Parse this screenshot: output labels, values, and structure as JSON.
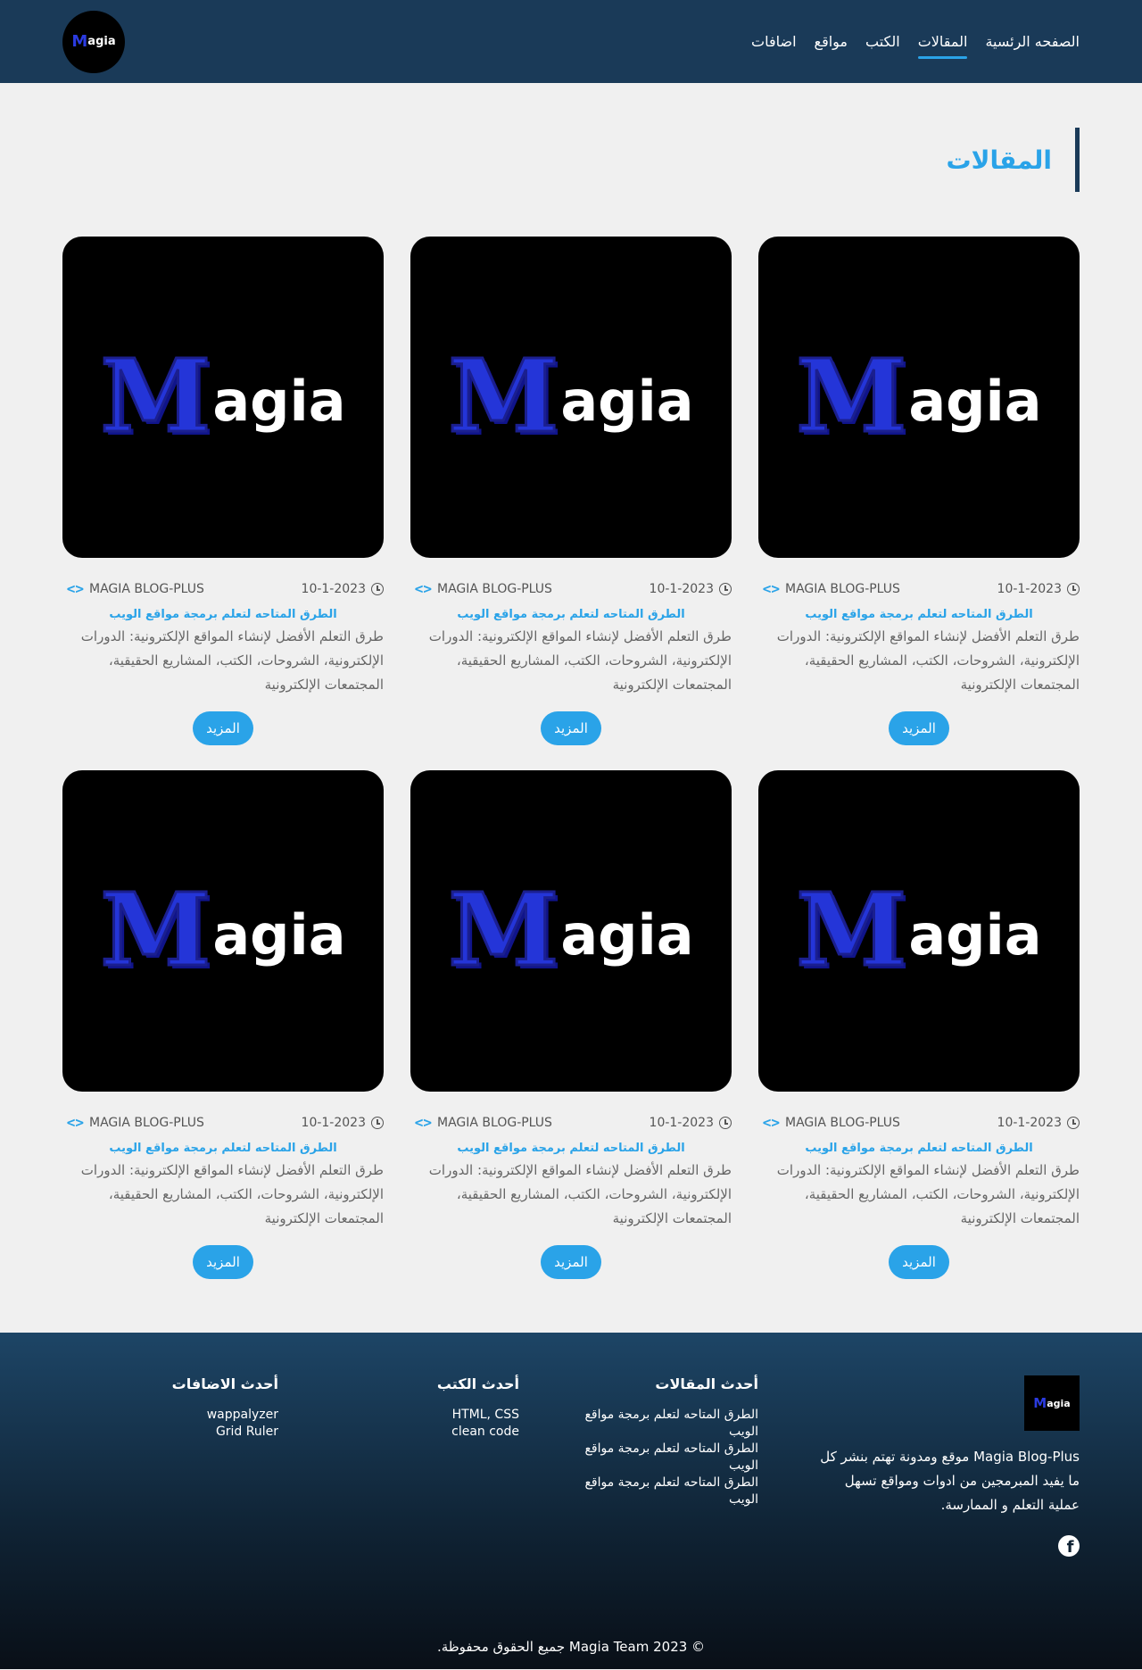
{
  "header": {
    "logo": {
      "m": "M",
      "rest": "agia"
    },
    "nav": [
      {
        "label": "الصفحه الرئسية",
        "active": false
      },
      {
        "label": "المقالات",
        "active": true
      },
      {
        "label": "الكتب",
        "active": false
      },
      {
        "label": "مواقع",
        "active": false
      },
      {
        "label": "اضافات",
        "active": false
      }
    ]
  },
  "main": {
    "section_title": "المقالات",
    "cards": [
      {
        "image_m": "M",
        "image_rest": "agia",
        "date": "10-1-2023",
        "author": "MAGIA BLOG-PLUS",
        "title": "الطرق المتاحه لتعلم برمجة مواقع الويب",
        "text": "طرق التعلم الأفضل لإنشاء المواقع الإلكترونية: الدورات الإلكترونية، الشروحات، الكتب، المشاريع الحقيقية، المجتمعات الإلكترونية",
        "button": "المزيد"
      },
      {
        "image_m": "M",
        "image_rest": "agia",
        "date": "10-1-2023",
        "author": "MAGIA BLOG-PLUS",
        "title": "الطرق المتاحه لتعلم برمجة مواقع الويب",
        "text": "طرق التعلم الأفضل لإنشاء المواقع الإلكترونية: الدورات الإلكترونية، الشروحات، الكتب، المشاريع الحقيقية، المجتمعات الإلكترونية",
        "button": "المزيد"
      },
      {
        "image_m": "M",
        "image_rest": "agia",
        "date": "10-1-2023",
        "author": "MAGIA BLOG-PLUS",
        "title": "الطرق المتاحه لتعلم برمجة مواقع الويب",
        "text": "طرق التعلم الأفضل لإنشاء المواقع الإلكترونية: الدورات الإلكترونية، الشروحات، الكتب، المشاريع الحقيقية، المجتمعات الإلكترونية",
        "button": "المزيد"
      },
      {
        "image_m": "M",
        "image_rest": "agia",
        "date": "10-1-2023",
        "author": "MAGIA BLOG-PLUS",
        "title": "الطرق المتاحه لتعلم برمجة مواقع الويب",
        "text": "طرق التعلم الأفضل لإنشاء المواقع الإلكترونية: الدورات الإلكترونية، الشروحات، الكتب، المشاريع الحقيقية، المجتمعات الإلكترونية",
        "button": "المزيد"
      },
      {
        "image_m": "M",
        "image_rest": "agia",
        "date": "10-1-2023",
        "author": "MAGIA BLOG-PLUS",
        "title": "الطرق المتاحه لتعلم برمجة مواقع الويب",
        "text": "طرق التعلم الأفضل لإنشاء المواقع الإلكترونية: الدورات الإلكترونية، الشروحات، الكتب، المشاريع الحقيقية، المجتمعات الإلكترونية",
        "button": "المزيد"
      },
      {
        "image_m": "M",
        "image_rest": "agia",
        "date": "10-1-2023",
        "author": "MAGIA BLOG-PLUS",
        "title": "الطرق المتاحه لتعلم برمجة مواقع الويب",
        "text": "طرق التعلم الأفضل لإنشاء المواقع الإلكترونية: الدورات الإلكترونية، الشروحات، الكتب، المشاريع الحقيقية، المجتمعات الإلكترونية",
        "button": "المزيد"
      }
    ]
  },
  "footer": {
    "logo": {
      "m": "M",
      "rest": "agia"
    },
    "about": "Magia Blog-Plus موقع ومدونة تهتم بنشر كل ما يفيد المبرمجين من ادوات ومواقع تسهل عملية التعلم و الممارسة.",
    "facebook_icon": "facebook-icon",
    "articles": {
      "heading": "أحدث المقالات",
      "items": [
        "الطرق المتاحه لتعلم برمجة مواقع الويب",
        "الطرق المتاحه لتعلم برمجة مواقع الويب",
        "الطرق المتاحه لتعلم برمجة مواقع الويب"
      ]
    },
    "books": {
      "heading": "أحدث الكتب",
      "items": [
        "HTML, CSS",
        "clean code"
      ]
    },
    "addons": {
      "heading": "أحدث الاضافات",
      "items": [
        "wappalyzer",
        "Grid Ruler"
      ]
    },
    "copyright": "© Magia Team 2023 جميع الحقوق محفوظة."
  },
  "colors": {
    "accent": "#2aa3e8",
    "header_bg": "#1a3a58",
    "logo_m": "#2435d8"
  }
}
